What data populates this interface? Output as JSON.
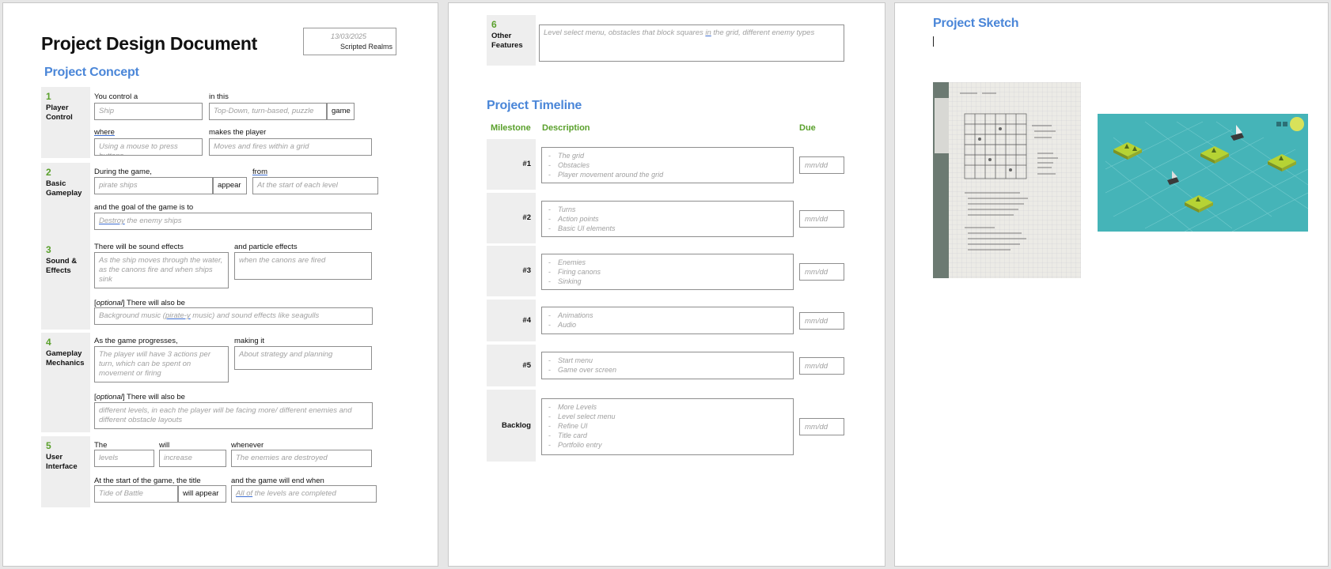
{
  "page1": {
    "title": "Project Design Document",
    "header": {
      "date": "13/03/2025",
      "org": "Scripted Realms"
    },
    "concept_title": "Project Concept",
    "sections": [
      {
        "num": "1",
        "caption": "Player Control",
        "labels": {
          "a": "You control a",
          "b": "in this",
          "c": "where",
          "d": "makes the player"
        },
        "fields": {
          "a": "Ship",
          "b": "Top-Down, turn-based, puzzle",
          "c": "Using a mouse to press buttons",
          "d": "Moves and fires within a grid"
        },
        "words": {
          "game": "game"
        }
      },
      {
        "num": "2",
        "caption": "Basic Gameplay",
        "labels": {
          "a": "During the game,",
          "b": "from",
          "c": "and the goal of the game is to"
        },
        "fields": {
          "a": "pirate ships",
          "b": "At the start of each level",
          "c_pre": "Destroy",
          "c_post": " the enemy ships"
        },
        "words": {
          "appear": "appear"
        }
      },
      {
        "num": "3",
        "caption": "Sound & Effects",
        "labels": {
          "a": "There will be sound effects",
          "b": "and particle effects",
          "c_pre": "[",
          "c_opt": "optional",
          "c_post": "] There will also be"
        },
        "fields": {
          "a": "As the ship moves through the water, as the canons fire and when ships sink",
          "b": "when the canons are fired",
          "c_pre": "Background music (",
          "c_mid": "pirate-y",
          "c_post": " music) and sound effects like seagulls"
        }
      },
      {
        "num": "4",
        "caption": "Gameplay Mechanics",
        "labels": {
          "a": "As the game progresses,",
          "b": "making it",
          "c_pre": "[",
          "c_opt": "optional",
          "c_post": "] There will also be"
        },
        "fields": {
          "a": "The player will have 3 actions per turn, which can be spent on movement or firing",
          "b": "About strategy and planning",
          "c": "different levels, in each the player will be facing more/ different enemies and different obstacle layouts"
        }
      },
      {
        "num": "5",
        "caption": "User Interface",
        "labels": {
          "a": "The",
          "b": "will",
          "c": "whenever",
          "d": "At the start of the game, the title",
          "e": "and the game will end when"
        },
        "fields": {
          "a": "levels",
          "b": "increase",
          "c": "The enemies are destroyed",
          "d": "Tide of Battle",
          "e_pre": "All of",
          "e_post": " the levels are completed"
        },
        "words": {
          "will_appear": "will appear"
        }
      }
    ]
  },
  "page2": {
    "section6": {
      "num": "6",
      "caption": "Other Features",
      "field_pre": "Level select menu, obstacles that block squares ",
      "field_mid": "in",
      "field_post": " the grid, different enemy types"
    },
    "timeline_title": "Project Timeline",
    "columns": {
      "milestone": "Milestone",
      "description": "Description",
      "due": "Due"
    },
    "milestones": [
      {
        "label": "#1",
        "items": [
          "The grid",
          "Obstacles",
          "Player movement around the grid"
        ],
        "due": "mm/dd"
      },
      {
        "label": "#2",
        "items": [
          "Turns",
          "Action points",
          "Basic UI elements"
        ],
        "due": "mm/dd"
      },
      {
        "label": "#3",
        "items": [
          "Enemies",
          "Firing canons",
          "Sinking"
        ],
        "due": "mm/dd"
      },
      {
        "label": "#4",
        "items": [
          "Animations",
          "Audio"
        ],
        "due": "mm/dd"
      },
      {
        "label": "#5",
        "items": [
          "Start menu",
          "Game over screen"
        ],
        "due": "mm/dd"
      },
      {
        "label": "Backlog",
        "items": [
          "More Levels",
          "Level select menu",
          "Refine UI",
          "Title card",
          "Portfolio entry"
        ],
        "due": "mm/dd"
      }
    ],
    "dash": "-"
  },
  "page3": {
    "sketch_title": "Project Sketch"
  },
  "colors": {
    "accent_blue": "#4a86d8",
    "accent_green": "#5aa02c",
    "label_bg": "#eeeeee",
    "sea": "#45b4b8",
    "island": "#b6d334"
  }
}
